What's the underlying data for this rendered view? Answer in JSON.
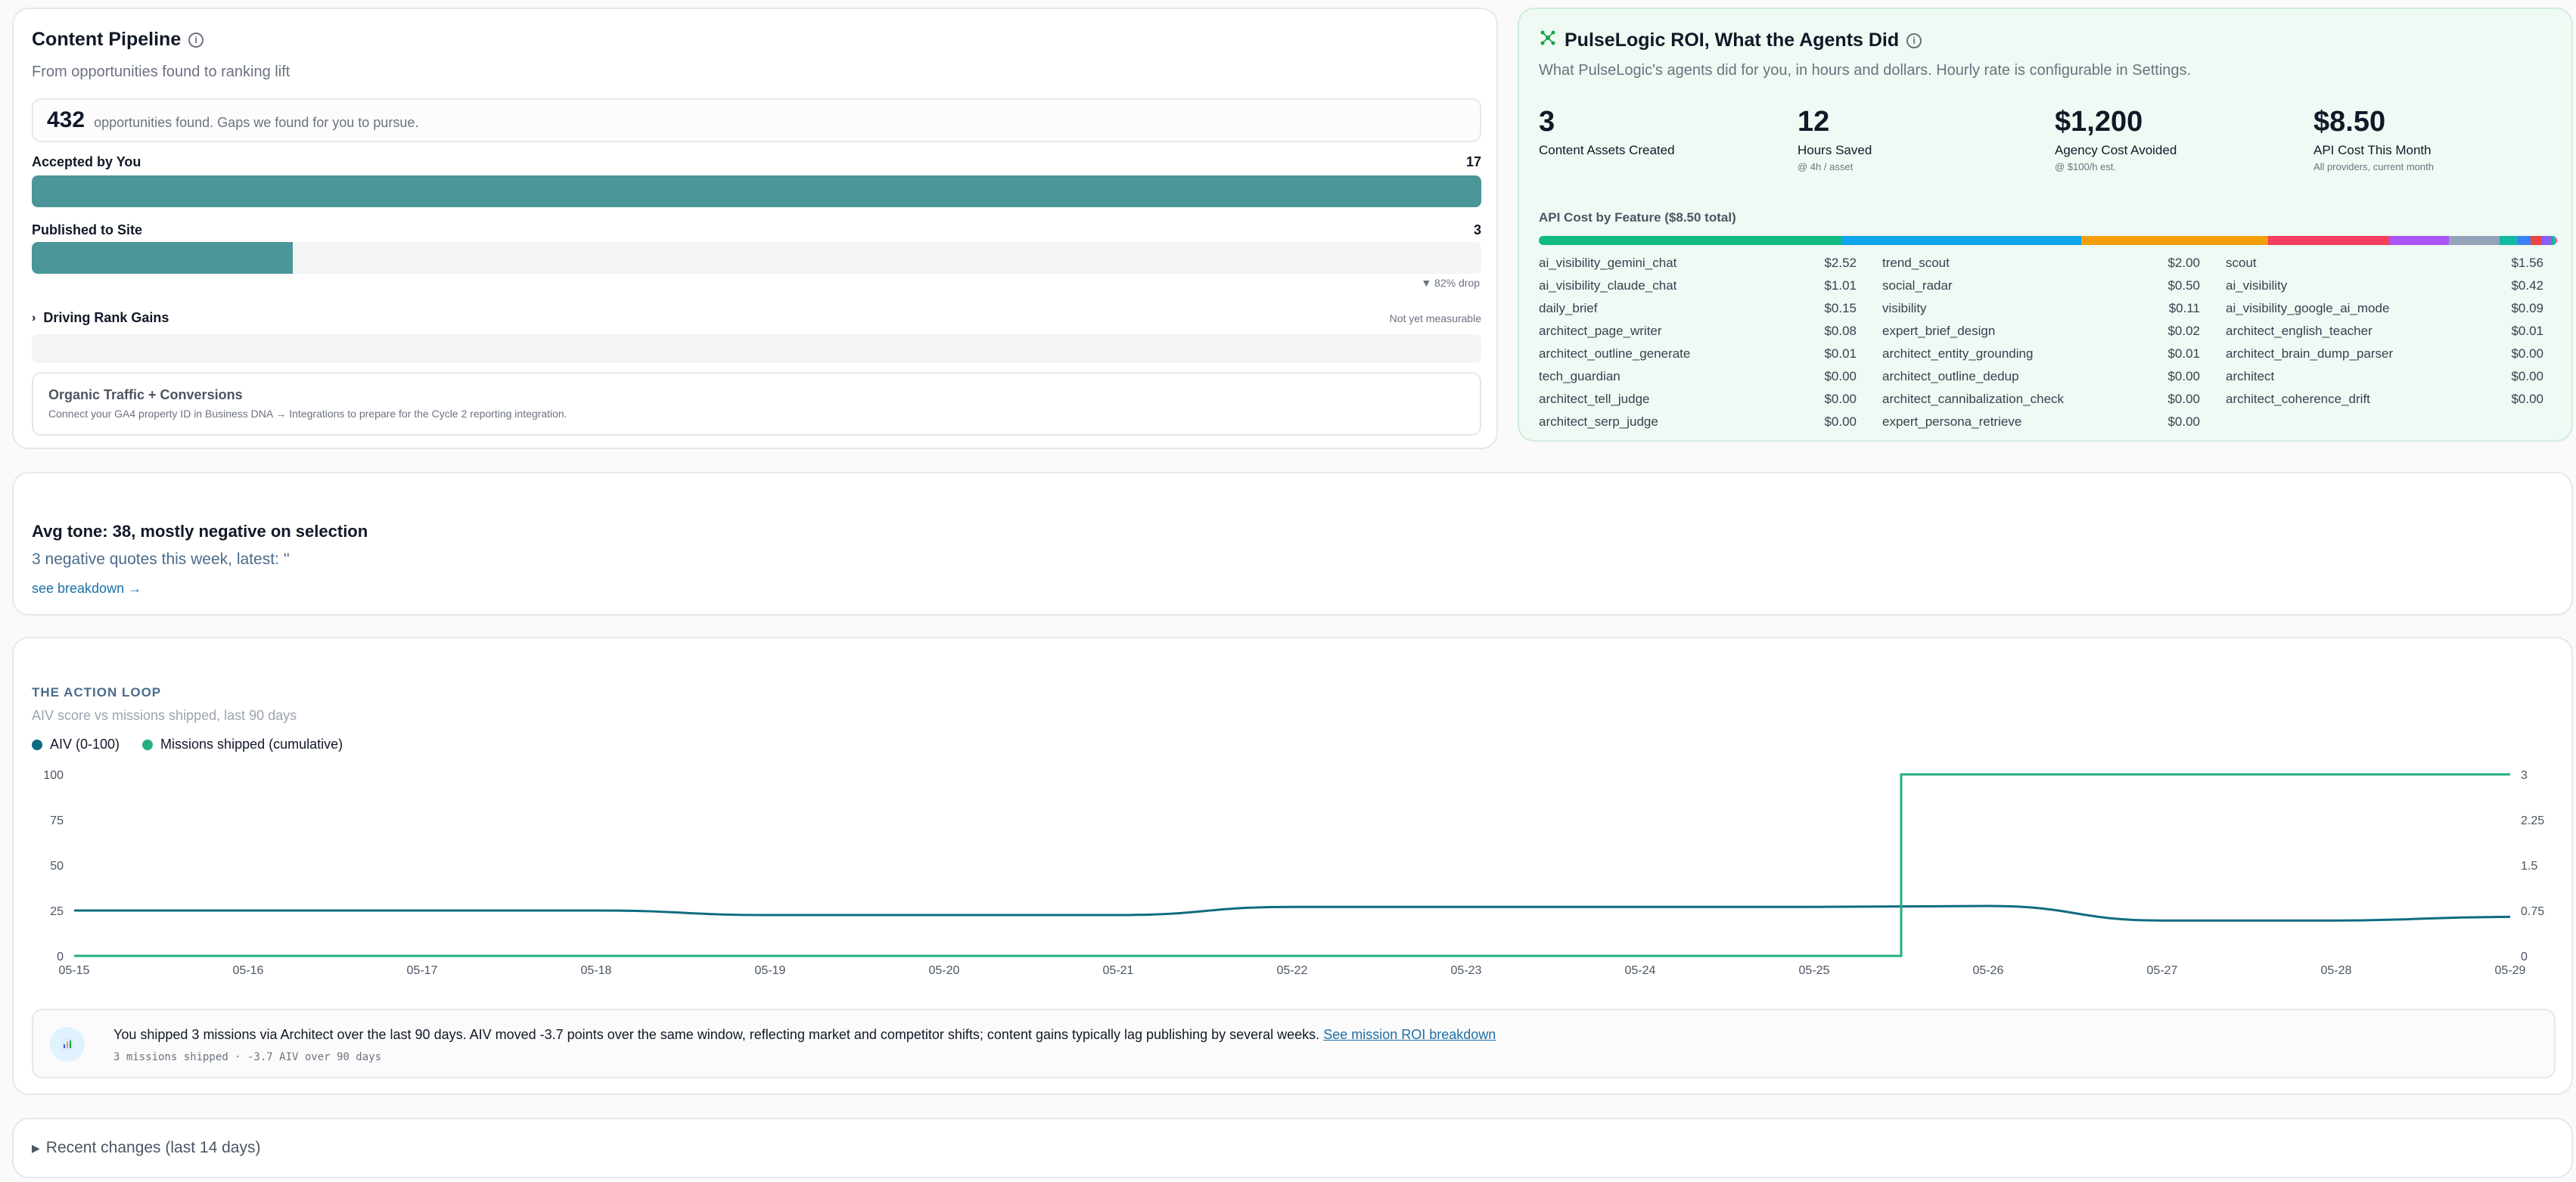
{
  "pipeline": {
    "title": "Content Pipeline",
    "subtitle": "From opportunities found to ranking lift",
    "opportunities_count": "432",
    "opportunities_label": "opportunities found. Gaps we found for you to pursue.",
    "accepted_label": "Accepted by You",
    "accepted_count": "17",
    "accepted_fill": 1.0,
    "published_label": "Published to Site",
    "published_count": "3",
    "published_fill": 0.18,
    "drop_note": "▼ 82% drop",
    "rank_label": "Driving Rank Gains",
    "rank_note": "Not yet measurable",
    "organic_title": "Organic Traffic + Conversions",
    "organic_text": "Connect your GA4 property ID in Business DNA → Integrations to prepare for the Cycle 2 reporting integration."
  },
  "roi": {
    "title": "PulseLogic ROI, What the Agents Did",
    "subtitle": "What PulseLogic's agents did for you, in hours and dollars. Hourly rate is configurable in Settings.",
    "kpis": [
      {
        "value": "3",
        "label": "Content Assets Created",
        "sub": ""
      },
      {
        "value": "12",
        "label": "Hours Saved",
        "sub": "@ 4h / asset"
      },
      {
        "value": "$1,200",
        "label": "Agency Cost Avoided",
        "sub": "@ $100/h est."
      },
      {
        "value": "$8.50",
        "label": "API Cost This Month",
        "sub": "All providers, current month"
      }
    ],
    "api_title": "API Cost by Feature ($8.50 total)",
    "stack_colors": [
      "#10b981",
      "#0ea5e9",
      "#f59e0b",
      "#f43f5e",
      "#a855f7",
      "#94a3b8",
      "#14b8a6",
      "#3b82f6",
      "#ef4444",
      "#8b5cf6"
    ],
    "features": [
      {
        "name": "ai_visibility_gemini_chat",
        "cost": "$2.52"
      },
      {
        "name": "trend_scout",
        "cost": "$2.00"
      },
      {
        "name": "scout",
        "cost": "$1.56"
      },
      {
        "name": "ai_visibility_claude_chat",
        "cost": "$1.01"
      },
      {
        "name": "social_radar",
        "cost": "$0.50"
      },
      {
        "name": "ai_visibility",
        "cost": "$0.42"
      },
      {
        "name": "daily_brief",
        "cost": "$0.15"
      },
      {
        "name": "visibility",
        "cost": "$0.11"
      },
      {
        "name": "ai_visibility_google_ai_mode",
        "cost": "$0.09"
      },
      {
        "name": "architect_page_writer",
        "cost": "$0.08"
      },
      {
        "name": "expert_brief_design",
        "cost": "$0.02"
      },
      {
        "name": "architect_english_teacher",
        "cost": "$0.01"
      },
      {
        "name": "architect_outline_generate",
        "cost": "$0.01"
      },
      {
        "name": "architect_entity_grounding",
        "cost": "$0.01"
      },
      {
        "name": "architect_brain_dump_parser",
        "cost": "$0.00"
      },
      {
        "name": "tech_guardian",
        "cost": "$0.00"
      },
      {
        "name": "architect_outline_dedup",
        "cost": "$0.00"
      },
      {
        "name": "architect",
        "cost": "$0.00"
      },
      {
        "name": "architect_tell_judge",
        "cost": "$0.00"
      },
      {
        "name": "architect_cannibalization_check",
        "cost": "$0.00"
      },
      {
        "name": "architect_coherence_drift",
        "cost": "$0.00"
      },
      {
        "name": "architect_serp_judge",
        "cost": "$0.00"
      },
      {
        "name": "expert_persona_retrieve",
        "cost": "$0.00"
      }
    ]
  },
  "tone": {
    "title": "Avg tone: 38, mostly negative on selection",
    "subtitle": "3 negative quotes this week, latest: ''",
    "link": "see breakdown →"
  },
  "loop": {
    "title": "THE ACTION LOOP",
    "subtitle": "AIV score vs missions shipped, last 90 days",
    "insight_text": "You shipped 3 missions via Architect over the last 90 days. AIV moved -3.7 points over the same window, reflecting market and competitor shifts; content gains typically lag publishing by several weeks.",
    "insight_link": "See mission ROI breakdown",
    "insight_mono": "3 missions shipped · -3.7 AIV over 90 days"
  },
  "chart_data": {
    "type": "line",
    "x": [
      "05-15",
      "05-16",
      "05-17",
      "05-18",
      "05-19",
      "05-20",
      "05-21",
      "05-22",
      "05-23",
      "05-24",
      "05-25",
      "05-26",
      "05-27",
      "05-28",
      "05-29"
    ],
    "series": [
      {
        "name": "AIV (0-100)",
        "axis": "left",
        "color": "#0f6b80",
        "values": [
          25,
          25,
          25,
          25,
          22.5,
          22.5,
          22.5,
          27,
          27,
          27,
          27,
          27.5,
          19.5,
          19.5,
          21.5
        ]
      },
      {
        "name": "Missions shipped (cumulative)",
        "axis": "right",
        "color": "#22b07d",
        "step": true,
        "values": [
          0,
          0,
          0,
          0,
          0,
          0,
          0,
          0,
          0,
          0,
          0,
          3,
          3,
          3,
          3
        ]
      }
    ],
    "y_left_ticks": [
      "0",
      "25",
      "50",
      "75",
      "100"
    ],
    "y_right_ticks": [
      "0",
      "0.75",
      "1.5",
      "2.25",
      "3"
    ],
    "ylim_left": [
      0,
      100
    ],
    "ylim_right": [
      0,
      3
    ]
  },
  "recent": {
    "label": "Recent changes (last 14 days)"
  }
}
